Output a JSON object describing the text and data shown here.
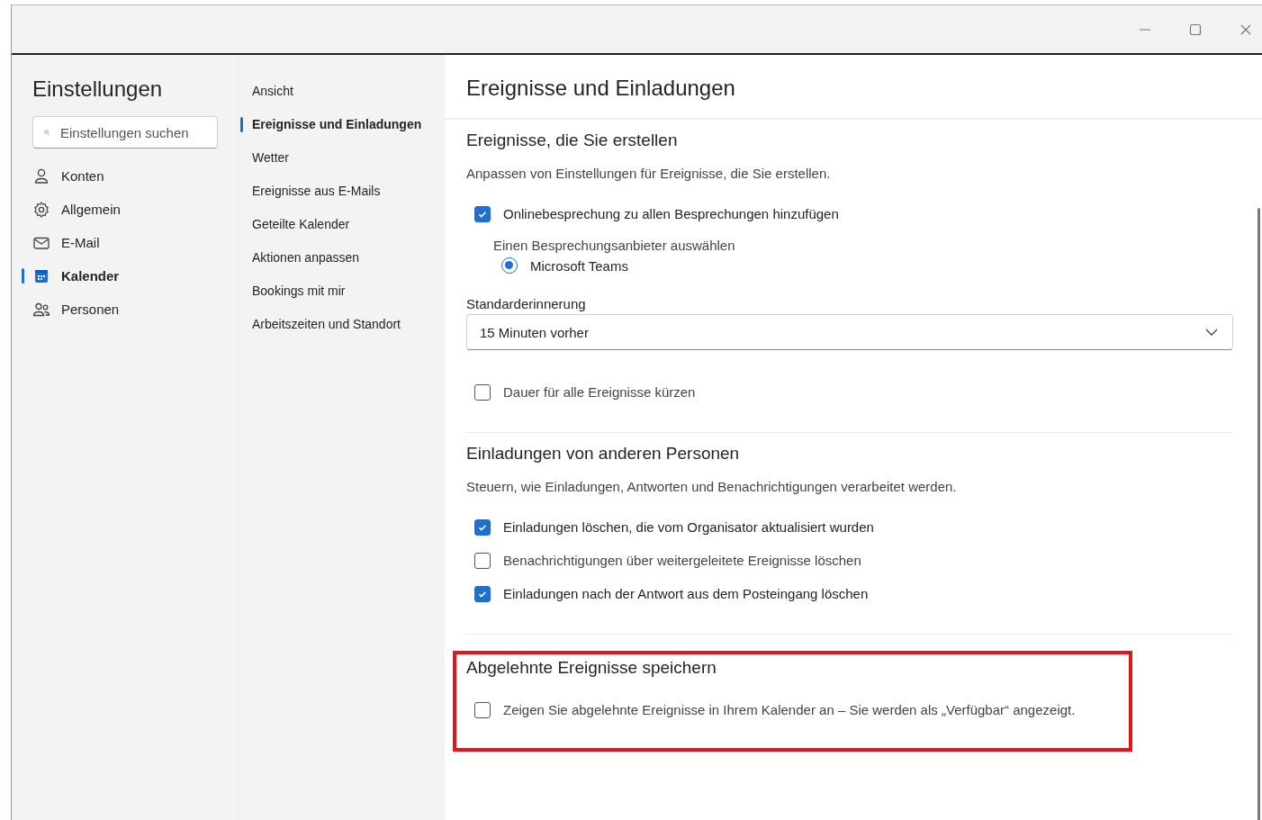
{
  "sidebar": {
    "title": "Einstellungen",
    "search": {
      "placeholder": "Einstellungen suchen"
    },
    "items": [
      {
        "label": "Konten",
        "selected": false
      },
      {
        "label": "Allgemein",
        "selected": false
      },
      {
        "label": "E-Mail",
        "selected": false
      },
      {
        "label": "Kalender",
        "selected": true
      },
      {
        "label": "Personen",
        "selected": false
      }
    ]
  },
  "subnav": {
    "items": [
      {
        "label": "Ansicht",
        "selected": false
      },
      {
        "label": "Ereignisse und Einladungen",
        "selected": true
      },
      {
        "label": "Wetter",
        "selected": false
      },
      {
        "label": "Ereignisse aus E-Mails",
        "selected": false
      },
      {
        "label": "Geteilte Kalender",
        "selected": false
      },
      {
        "label": "Aktionen anpassen",
        "selected": false
      },
      {
        "label": "Bookings mit mir",
        "selected": false
      },
      {
        "label": "Arbeitszeiten und Standort",
        "selected": false
      }
    ]
  },
  "content": {
    "title": "Ereignisse und Einladungen",
    "sections": [
      {
        "heading": "Ereignisse, die Sie erstellen",
        "description": "Anpassen von Einstellungen für Ereignisse, die Sie erstellen.",
        "highlighted": false,
        "items": [
          {
            "kind": "checkbox",
            "label": "Onlinebesprechung zu allen Besprechungen hinzufügen",
            "checked": true
          },
          {
            "kind": "sublabel",
            "label": "Einen Besprechungsanbieter auswählen"
          },
          {
            "kind": "radio",
            "label": "Microsoft Teams",
            "selected": true
          },
          {
            "kind": "dropdown",
            "label": "Standarderinnerung",
            "value": "15 Minuten vorher"
          },
          {
            "kind": "checkbox",
            "label": "Dauer für alle Ereignisse kürzen",
            "checked": false
          }
        ]
      },
      {
        "heading": "Einladungen von anderen Personen",
        "description": "Steuern, wie Einladungen, Antworten und Benachrichtigungen verarbeitet werden.",
        "highlighted": false,
        "items": [
          {
            "kind": "checkbox",
            "label": "Einladungen löschen, die vom Organisator aktualisiert wurden",
            "checked": true
          },
          {
            "kind": "checkbox",
            "label": "Benachrichtigungen über weitergeleitete Ereignisse löschen",
            "checked": false
          },
          {
            "kind": "checkbox",
            "label": "Einladungen nach der Antwort aus dem Posteingang löschen",
            "checked": true
          }
        ]
      },
      {
        "heading": "Abgelehnte Ereignisse speichern",
        "highlighted": true,
        "items": [
          {
            "kind": "checkbox",
            "label": "Zeigen Sie abgelehnte Ereignisse in Ihrem Kalender an – Sie werden als „Verfügbar“ angezeigt.",
            "checked": false
          }
        ]
      }
    ]
  }
}
